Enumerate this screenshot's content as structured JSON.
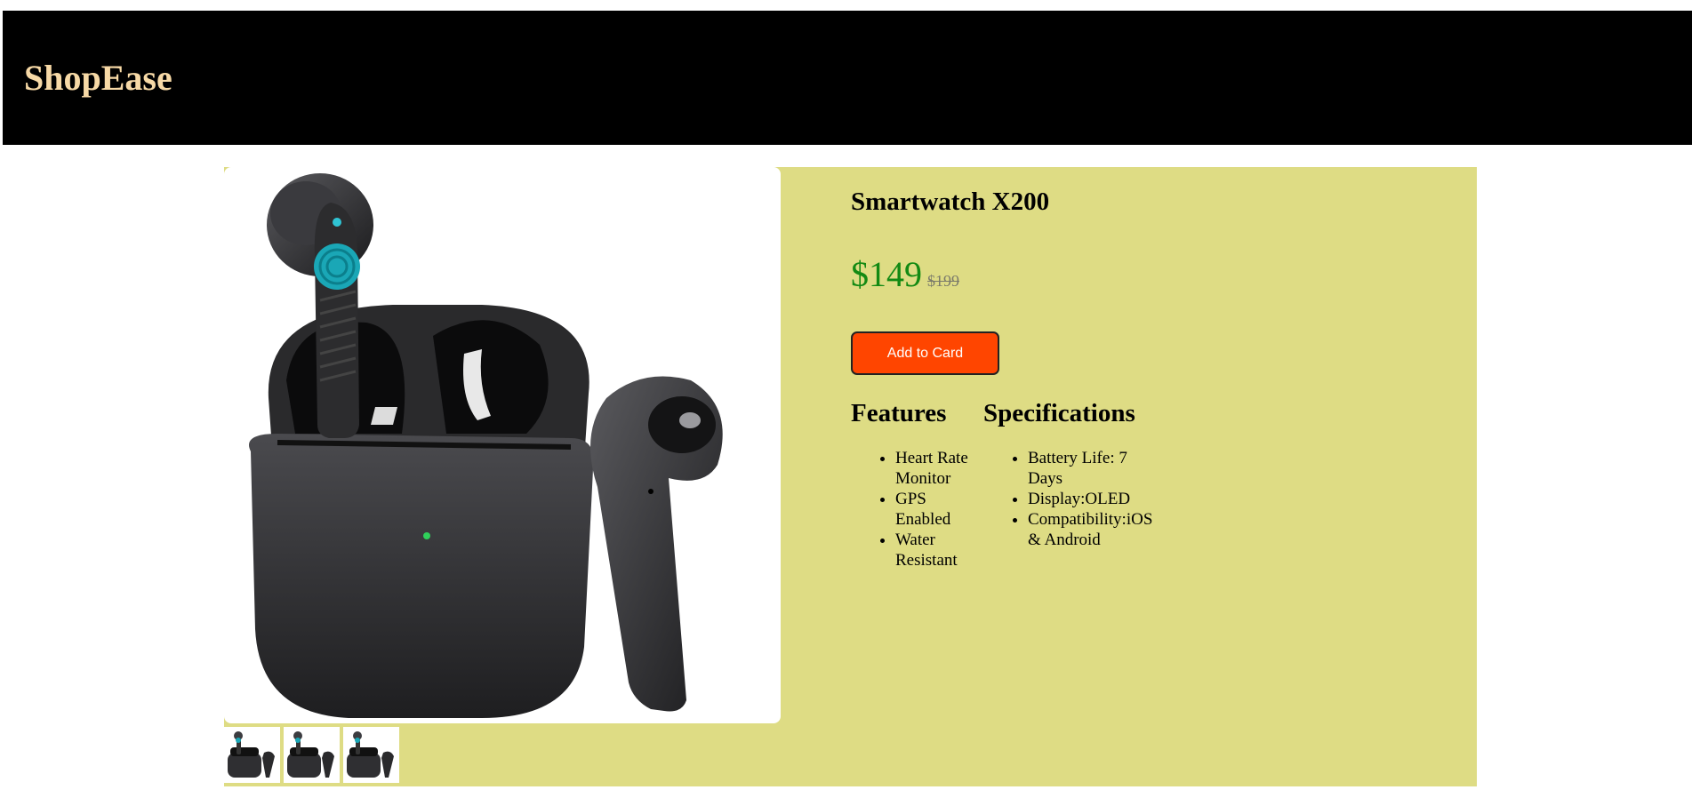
{
  "header": {
    "logo": "ShopEase",
    "background": "#000000",
    "logo_color": "#f7d9a6"
  },
  "product": {
    "name": "Smartwatch X200",
    "price": "$149",
    "old_price": "$199",
    "add_button_label": "Add to Card",
    "image_alt": "black wireless earbuds with charging case",
    "thumbnail_count": 3,
    "panel_color": "#dedc84",
    "button_color": "#ff4500",
    "price_color": "#138a13"
  },
  "features": {
    "heading": "Features",
    "items": [
      "Heart Rate Monitor",
      "GPS Enabled",
      "Water Resistant"
    ]
  },
  "specifications": {
    "heading": "Specifications",
    "items": [
      "Battery Life: 7 Days",
      "Display:OLED",
      "Compatibility:iOS & Android"
    ]
  }
}
